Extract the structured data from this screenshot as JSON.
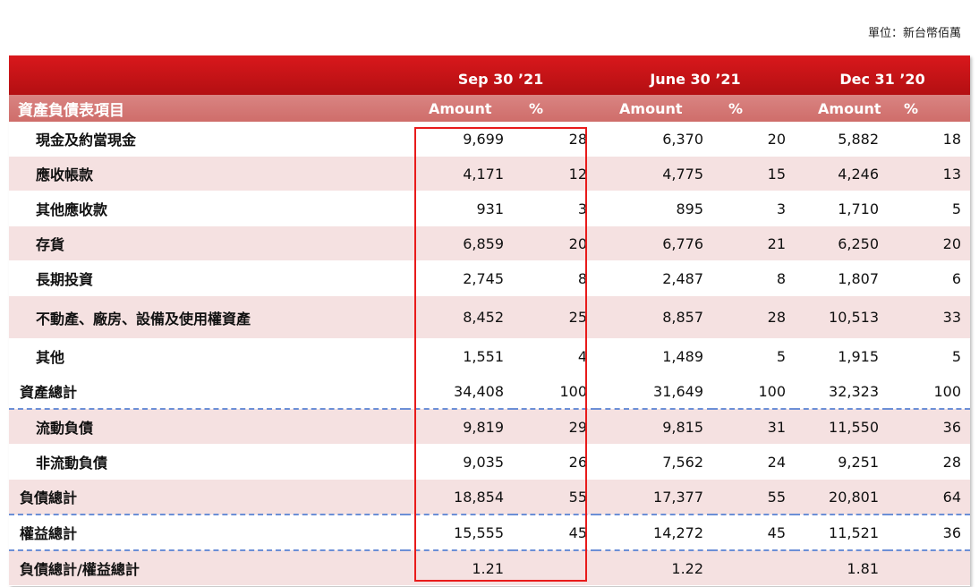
{
  "unit_label": "單位：新台幣佰萬",
  "header": {
    "item_label": "資產負債表項目",
    "periods": [
      "Sep 30 ’21",
      "June 30 ’21",
      "Dec 31 ’20"
    ],
    "amount_label": "Amount",
    "pct_label": "%"
  },
  "rows": [
    {
      "label": "現金及約當現金",
      "cells": [
        "9,699",
        "28",
        "6,370",
        "20",
        "5,882",
        "18"
      ]
    },
    {
      "label": "應收帳款",
      "cells": [
        "4,171",
        "12",
        "4,775",
        "15",
        "4,246",
        "13"
      ]
    },
    {
      "label": "其他應收款",
      "cells": [
        "931",
        "3",
        "895",
        "3",
        "1,710",
        "5"
      ]
    },
    {
      "label": "存貨",
      "cells": [
        "6,859",
        "20",
        "6,776",
        "21",
        "6,250",
        "20"
      ]
    },
    {
      "label": "長期投資",
      "cells": [
        "2,745",
        "8",
        "2,487",
        "8",
        "1,807",
        "6"
      ]
    },
    {
      "label": "不動產、廠房、設備及使用權資產",
      "cells": [
        "8,452",
        "25",
        "8,857",
        "28",
        "10,513",
        "33"
      ]
    },
    {
      "label": "其他",
      "cells": [
        "1,551",
        "4",
        "1,489",
        "5",
        "1,915",
        "5"
      ]
    },
    {
      "label": "資產總計",
      "cells": [
        "34,408",
        "100",
        "31,649",
        "100",
        "32,323",
        "100"
      ]
    },
    {
      "label": "流動負債",
      "cells": [
        "9,819",
        "29",
        "9,815",
        "31",
        "11,550",
        "36"
      ]
    },
    {
      "label": "非流動負債",
      "cells": [
        "9,035",
        "26",
        "7,562",
        "24",
        "9,251",
        "28"
      ]
    },
    {
      "label": "負債總計",
      "cells": [
        "18,854",
        "55",
        "17,377",
        "55",
        "20,801",
        "64"
      ]
    },
    {
      "label": "權益總計",
      "cells": [
        "15,555",
        "45",
        "14,272",
        "45",
        "11,521",
        "36"
      ]
    },
    {
      "label": "負債總計/權益總計",
      "cells": [
        "1.21",
        "",
        "1.22",
        "",
        "1.81",
        ""
      ]
    }
  ],
  "colors": {
    "header_red": "#c8131a",
    "subheader_pink": "#d4787a",
    "row_pink": "#f5e1e1",
    "highlight_red": "#e81b1b",
    "dash_blue": "#6c8fd6"
  }
}
